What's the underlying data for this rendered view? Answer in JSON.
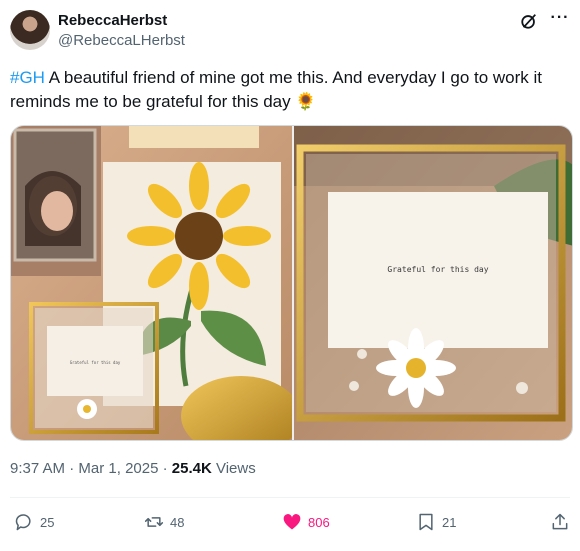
{
  "author": {
    "display_name": "RebeccaHerbst",
    "handle": "@RebeccaLHerbst"
  },
  "tweet": {
    "hashtag": "#GH",
    "text": " A beautiful friend of mine got me this. And everyday I go to work it reminds me to be grateful for this day",
    "emoji": "🌻"
  },
  "media": {
    "card_text": "Grateful for this day"
  },
  "meta": {
    "time": "9:37 AM",
    "separator": " · ",
    "date": "Mar 1, 2025",
    "views_count": "25.4K",
    "views_label": " Views"
  },
  "actions": {
    "replies": "25",
    "reposts": "48",
    "likes": "806",
    "bookmarks": "21"
  },
  "icons": [
    "grok-icon",
    "more-icon",
    "reply-icon",
    "repost-icon",
    "like-icon",
    "bookmark-icon",
    "share-icon"
  ],
  "colors": {
    "accent": "#1d9bf0",
    "like": "#f91880",
    "muted": "#536471"
  }
}
